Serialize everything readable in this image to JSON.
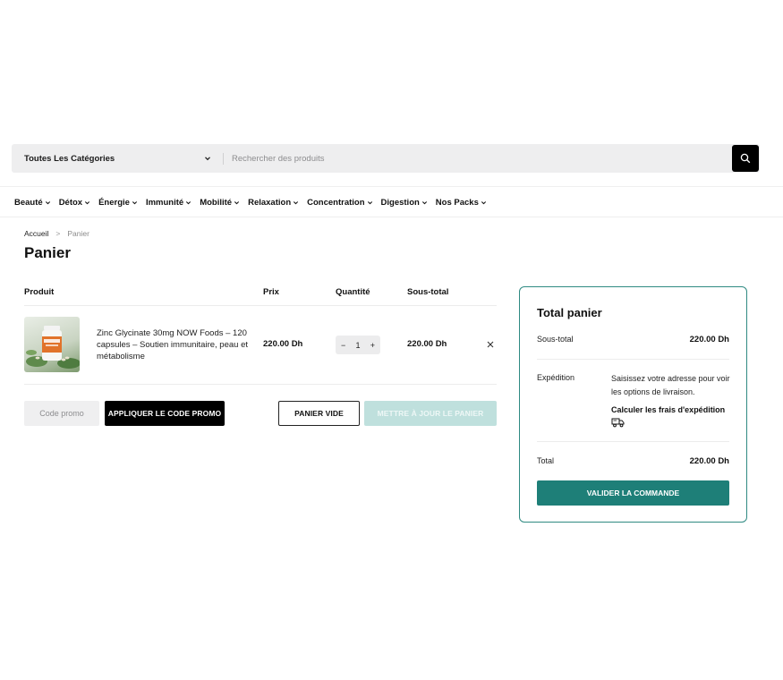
{
  "search": {
    "category_label": "Toutes Les Catégories",
    "placeholder": "Rechercher des produits"
  },
  "nav": {
    "items": [
      {
        "label": "Beauté"
      },
      {
        "label": "Détox"
      },
      {
        "label": "Énergie"
      },
      {
        "label": "Immunité"
      },
      {
        "label": "Mobilité"
      },
      {
        "label": "Relaxation"
      },
      {
        "label": "Concentration"
      },
      {
        "label": "Digestion"
      },
      {
        "label": "Nos Packs"
      }
    ]
  },
  "breadcrumb": {
    "home": "Accueil",
    "separator": ">",
    "current": "Panier"
  },
  "page": {
    "title": "Panier"
  },
  "cart": {
    "headers": {
      "product": "Produit",
      "price": "Prix",
      "quantity": "Quantité",
      "subtotal": "Sous-total"
    },
    "items": [
      {
        "name": "Zinc Glycinate 30mg NOW Foods – 120 capsules – Soutien immunitaire, peau et métabolisme",
        "price": "220.00 Dh",
        "quantity": "1",
        "subtotal": "220.00 Dh"
      }
    ],
    "qty_minus": "−",
    "qty_plus": "+"
  },
  "actions": {
    "promo_placeholder": "Code promo",
    "apply_label": "APPLIQUER LE CODE PROMO",
    "empty_label": "PANIER VIDE",
    "update_label": "METTRE À JOUR LE PANIER"
  },
  "totals": {
    "title": "Total panier",
    "subtotal_label": "Sous-total",
    "subtotal_value": "220.00 Dh",
    "shipping_label": "Expédition",
    "shipping_text": "Saisissez votre adresse pour voir les options de livraison.",
    "shipping_calc": "Calculer les frais d'expédition",
    "total_label": "Total",
    "total_value": "220.00 Dh",
    "checkout_label": "VALIDER LA COMMANDE"
  },
  "colors": {
    "accent": "#1e7f78",
    "accent_border": "#2f8a82",
    "update_disabled": "#bfe0dd"
  }
}
